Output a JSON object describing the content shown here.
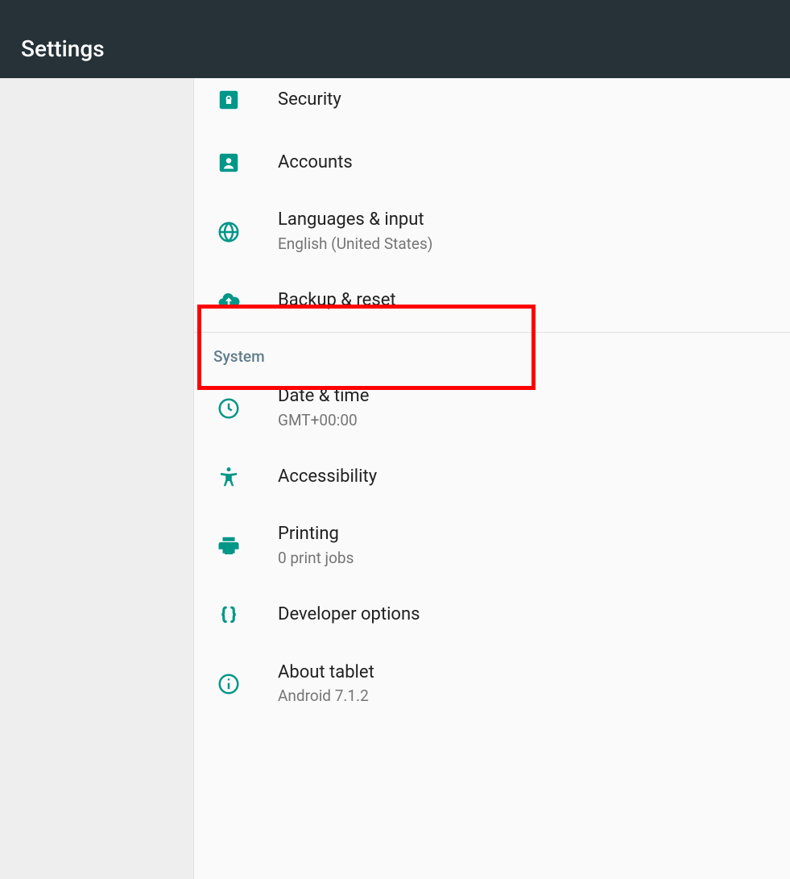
{
  "header": {
    "title": "Settings"
  },
  "sections": {
    "personal": {
      "items": [
        {
          "name": "security",
          "label": "Security",
          "sub": null
        },
        {
          "name": "accounts",
          "label": "Accounts",
          "sub": null
        },
        {
          "name": "languages-input",
          "label": "Languages & input",
          "sub": "English (United States)"
        },
        {
          "name": "backup-reset",
          "label": "Backup & reset",
          "sub": null
        }
      ]
    },
    "system": {
      "header": "System",
      "items": [
        {
          "name": "date-time",
          "label": "Date & time",
          "sub": "GMT+00:00"
        },
        {
          "name": "accessibility",
          "label": "Accessibility",
          "sub": null
        },
        {
          "name": "printing",
          "label": "Printing",
          "sub": "0 print jobs"
        },
        {
          "name": "developer-options",
          "label": "Developer options",
          "sub": null
        },
        {
          "name": "about-tablet",
          "label": "About tablet",
          "sub": "Android 7.1.2"
        }
      ]
    }
  },
  "colors": {
    "accent": "#009688"
  }
}
